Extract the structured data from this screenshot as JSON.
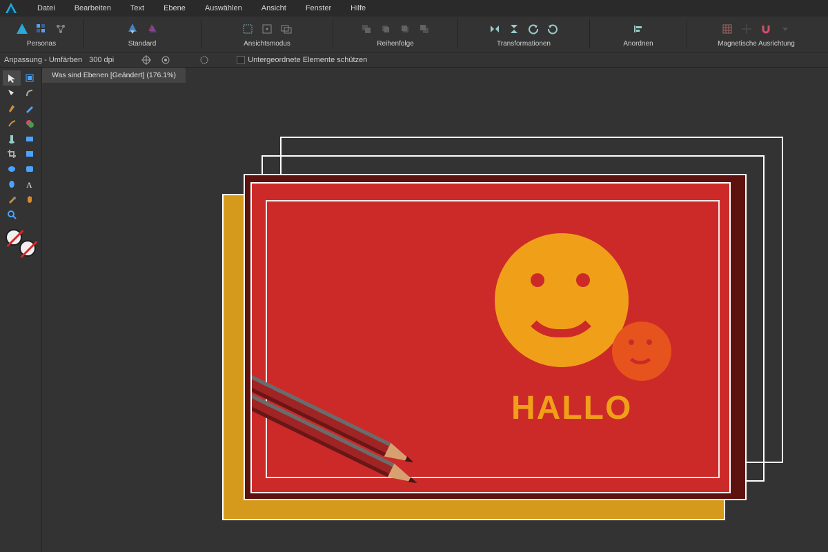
{
  "menu": {
    "items": [
      "Datei",
      "Bearbeiten",
      "Text",
      "Ebene",
      "Auswählen",
      "Ansicht",
      "Fenster",
      "Hilfe"
    ]
  },
  "toolbar": {
    "groups": [
      {
        "name": "personas",
        "label": "Personas"
      },
      {
        "name": "standard",
        "label": "Standard"
      },
      {
        "name": "view-mode",
        "label": "Ansichtsmodus"
      },
      {
        "name": "order",
        "label": "Reihenfolge"
      },
      {
        "name": "transform",
        "label": "Transformationen"
      },
      {
        "name": "arrange",
        "label": "Anordnen"
      },
      {
        "name": "snapping",
        "label": "Magnetische Ausrichtung"
      }
    ]
  },
  "options": {
    "adjustment": "Anpassung - Umfärben",
    "dpi": "300 dpi",
    "protect_children": "Untergeordnete Elemente schützen"
  },
  "document": {
    "tab_label": "Was sind Ebenen [Geändert] (176.1%)"
  },
  "canvas": {
    "text": "HALLO",
    "colors": {
      "yellow": "#d59a1c",
      "darkred": "#5e120f",
      "red": "#cc2a29",
      "smiley": "#f0a018",
      "orange": "#e6531d"
    }
  },
  "tools": {
    "front_color": "#f0f0f0",
    "back_color": "#f0f0f0"
  }
}
